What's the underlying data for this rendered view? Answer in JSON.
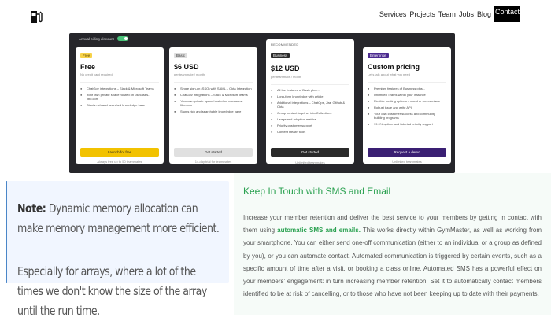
{
  "header": {
    "logo_icon": "fuel-pump-icon",
    "nav": [
      "Services",
      "Projects",
      "Team",
      "Jobs",
      "Blog",
      "Contact"
    ],
    "active": "Contact"
  },
  "pricing": {
    "toggle_label": "Annual billing discount",
    "cards": [
      {
        "badge": "Free",
        "name": "Free",
        "sub": "No credit card required",
        "features": [
          "ChatGov integrations – Slack & Microsoft Teams",
          "Your own private space hosted on usecases-fibo.com",
          "Stunts rich and searched knowledge base"
        ],
        "cta": "Launch for free",
        "foot": "Always free up to 50 teammates"
      },
      {
        "badge": "Basic",
        "name": "$6 USD",
        "sub": "per teammate / month",
        "features": [
          "Single sign-on (SSO) with SAML – Okta Integration",
          "ChatGov integrations – Slack & Microsoft Teams",
          "Your own private space hosted on usecases-fibo.com",
          "Stunts rich and searchable knowledge base"
        ],
        "cta": "Get started",
        "foot": "14-day trial for teammates"
      },
      {
        "recommended": "RECOMMENDED",
        "badge": "Business",
        "name": "$12 USD",
        "sub": "per teammate / month",
        "features": [
          "All the features of Basic plus...",
          "Long-form knowledge with article",
          "Additional integrations – ChatOps, Jira, Github & Okta",
          "Group content together into Collections",
          "Usage and adoption metrics",
          "Priority customer support",
          "Content Health tools"
        ],
        "cta": "Get started",
        "foot": "Unlimited teammates"
      },
      {
        "badge": "Enterprise",
        "name": "Custom pricing",
        "sub": "Let's talk about what you need",
        "features": [
          "Premium features of Business plus...",
          "Unlimited Teams within your instance",
          "Flexible hosting options – cloud or on-premises",
          "Robust issue and write API",
          "Your own customer success and community building programs",
          "99.9% uptime and ticketed priority support"
        ],
        "cta": "Request a demo",
        "foot": "Unlimited teammates"
      }
    ]
  },
  "note": {
    "label": "Note:",
    "p1_text": " Dynamic memory allocation can make memory management more efficient.",
    "p2_text": "Especially for arrays, where a lot of the times we don't know the size of the array until the run time."
  },
  "section": {
    "title": "Keep In Touch with SMS and Email",
    "body_before": "Increase your member retention and deliver the best service to your members by getting in contact with them using ",
    "body_highlight": "automatic SMS and emails.",
    "body_after": " This works directly within GymMaster, as well as working from your smartphone. You can either send one-off communication (either to an individual or a group as defined by you), or you can automate contact. Automated communication is triggered by certain events, such as a specific amount of time after a visit, or booking a class online. Automated SMS has a powerful effect on your members' engagement: in turn increasing member retention. Set it to automatically contact members identified to be at risk of cancelling, or to those who have not been keeping up to date with their payments."
  },
  "colors": {
    "accent_green": "#2aa150",
    "note_border": "#4a86c8",
    "pricing_bg": "#26262b"
  }
}
